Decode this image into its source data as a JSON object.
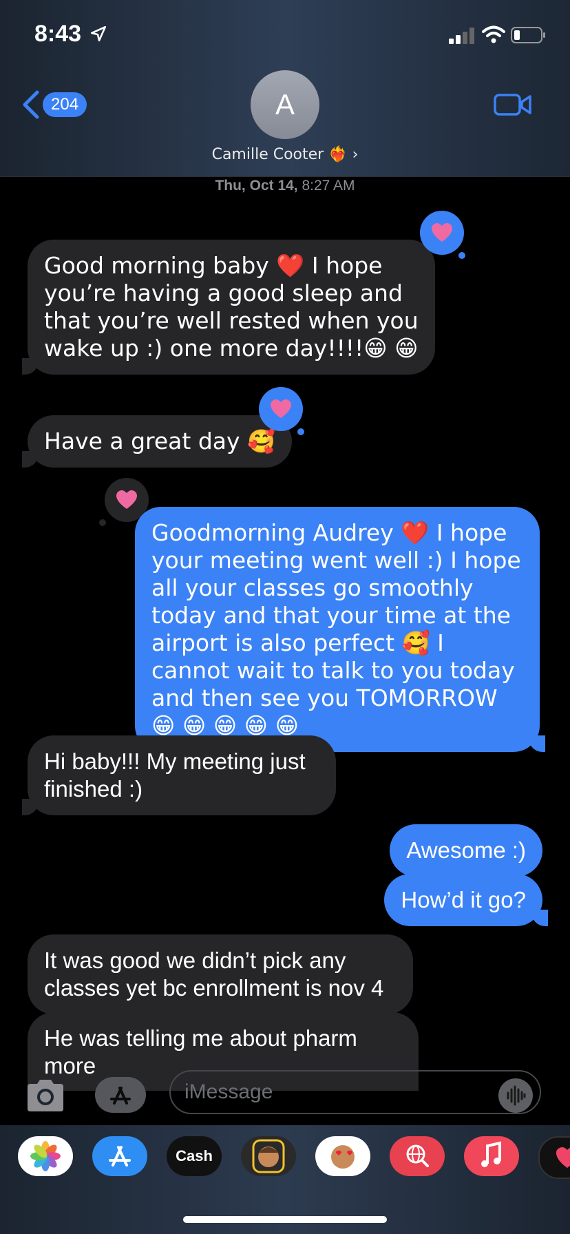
{
  "status_bar": {
    "time": "8:43"
  },
  "header": {
    "back_count": "204",
    "avatar_letter": "A",
    "contact_name": "Camille Cooter ❤️‍🔥 ›",
    "timestamp_day": "Thu, Oct 14,",
    "timestamp_time": "8:27 AM"
  },
  "messages": [
    {
      "side": "in",
      "text": "Good morning baby ❤️ I hope you’re having a good sleep and that you’re well rested when you wake up :) one more day!!!!😁 😁",
      "reaction": "heart"
    },
    {
      "side": "in",
      "text": "Have a great day 🥰",
      "reaction": "heart"
    },
    {
      "side": "out",
      "text": "Goodmorning Audrey ❤️ I hope your meeting went well :) I hope all your classes go smoothly today and that your time at the airport is also perfect 🥰 I cannot wait to talk to you today and then see you TOMORROW 😁 😁 😁 😁 😁",
      "reaction": "heart"
    },
    {
      "side": "in",
      "text": "Hi baby!!! My meeting just finished :)"
    },
    {
      "side": "out",
      "text": "Awesome :)"
    },
    {
      "side": "out",
      "text": "How’d it go?"
    },
    {
      "side": "in",
      "text": "It was good we didn’t pick any classes yet bc enrollment is nov 4"
    },
    {
      "side": "in",
      "text": "He was telling me about pharm more"
    }
  ],
  "composer": {
    "placeholder": "iMessage"
  },
  "app_drawer": {
    "items": [
      {
        "name": "photos"
      },
      {
        "name": "app-store"
      },
      {
        "name": "apple-cash",
        "label": "Cash"
      },
      {
        "name": "memoji-stickers"
      },
      {
        "name": "animoji"
      },
      {
        "name": "images-search"
      },
      {
        "name": "music"
      },
      {
        "name": "digital-touch"
      }
    ]
  },
  "colors": {
    "outgoing_bubble": "#3b82f6",
    "incoming_bubble": "#262628",
    "tapback_heart": "#ef6aa2",
    "background": "#000000"
  }
}
